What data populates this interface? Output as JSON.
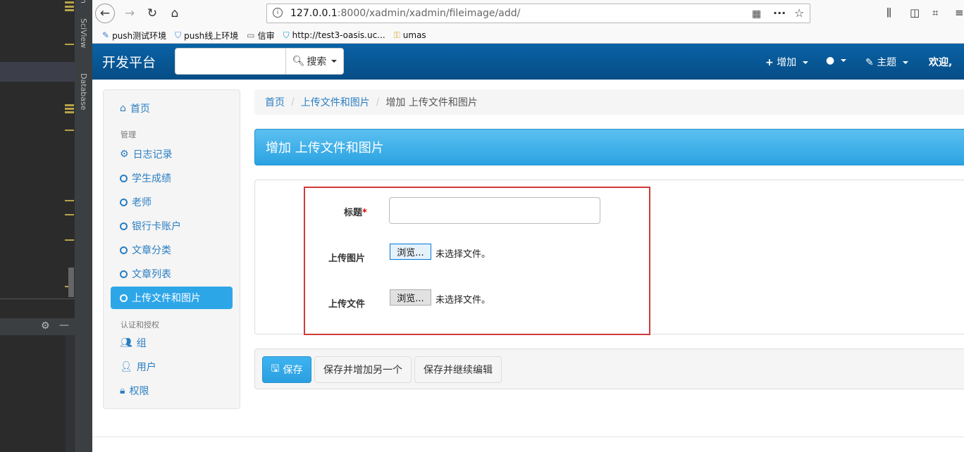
{
  "ide": {
    "tab_sciview": "SciView",
    "tab_database": "Database",
    "tab_top": "n"
  },
  "browser": {
    "url_host": "127.0.0.1",
    "url_rest": ":8000/xadmin/xadmin/fileimage/add/",
    "bookmarks": [
      {
        "label": "push测试环境",
        "icon": "puzzle-icon"
      },
      {
        "label": "push线上环境",
        "icon": "shield-icon"
      },
      {
        "label": "信审",
        "icon": "folder-icon"
      },
      {
        "label": "http://test3-oasis.uc...",
        "icon": "shield-icon"
      },
      {
        "label": "umas",
        "icon": "key-icon"
      }
    ]
  },
  "navbar": {
    "brand": "开发平台",
    "search_placeholder": "",
    "search_label": "搜索",
    "add_label": "增加",
    "theme_label": "主题",
    "welcome": "欢迎,"
  },
  "sidebar": {
    "home": "首页",
    "section_manage": "管理",
    "section_auth": "认证和授权",
    "items": [
      {
        "label": "日志记录",
        "icon": "gear-icon"
      },
      {
        "label": "学生成绩",
        "icon": "circle-icon"
      },
      {
        "label": "老师",
        "icon": "circle-icon"
      },
      {
        "label": "银行卡账户",
        "icon": "circle-icon"
      },
      {
        "label": "文章分类",
        "icon": "circle-icon"
      },
      {
        "label": "文章列表",
        "icon": "circle-icon"
      },
      {
        "label": "上传文件和图片",
        "icon": "circle-icon"
      }
    ],
    "auth_items": [
      {
        "label": "组",
        "icon": "users-icon"
      },
      {
        "label": "用户",
        "icon": "user-icon"
      },
      {
        "label": "权限",
        "icon": "lock-icon"
      }
    ]
  },
  "breadcrumb": {
    "home": "首页",
    "model": "上传文件和图片",
    "current": "增加 上传文件和图片"
  },
  "page": {
    "title": "增加 上传文件和图片"
  },
  "form": {
    "title_label": "标题",
    "required_mark": "*",
    "title_value": "",
    "image_label": "上传图片",
    "file_label": "上传文件",
    "browse_label": "浏览...",
    "no_file_text": "未选择文件。"
  },
  "actions": {
    "save": "保存",
    "save_add_another": "保存并增加另一个",
    "save_continue": "保存并继续编辑"
  },
  "colors": {
    "navbar": "#0a62a6",
    "primary": "#2da6e8",
    "link": "#2a7ec2",
    "highlight_border": "#d03a3a"
  }
}
